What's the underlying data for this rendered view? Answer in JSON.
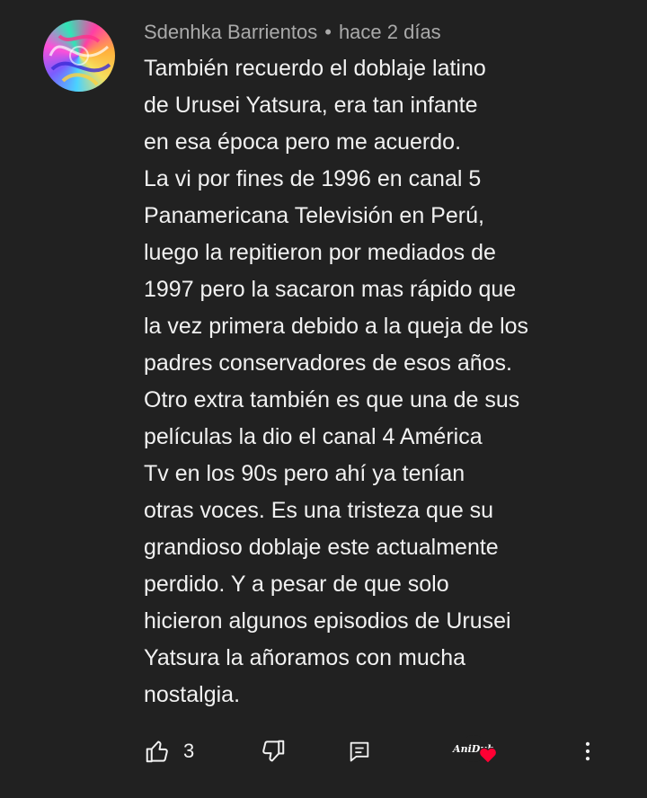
{
  "comment": {
    "author": "Sdenhka Barrientos",
    "separator": "•",
    "time": "hace 2 días",
    "lines": [
      "También recuerdo el doblaje latino",
      "de Urusei Yatsura, era tan infante",
      "en esa época pero me acuerdo.",
      "La vi por fines de 1996 en canal 5",
      "Panamericana Televisión en Perú,",
      "luego la repitieron por mediados de",
      "1997 pero la sacaron mas rápido que",
      "la vez primera debido a la queja de los",
      "padres conservadores de esos años.",
      "Otro extra también es que una de sus",
      "películas la dio el canal 4 América",
      "Tv en los 90s pero ahí ya tenían",
      "otras voces. Es una tristeza que su",
      "grandioso doblaje este actualmente",
      "perdido. Y a pesar de que solo",
      "hicieron algunos episodios de Urusei",
      "Yatsura la añoramos con mucha",
      "nostalgia."
    ]
  },
  "actions": {
    "like_count": "3",
    "creator_badge_text": "AniDub",
    "icons": {
      "like": "thumbs-up-icon",
      "dislike": "thumbs-down-icon",
      "reply": "reply-comment-icon",
      "creator_heart": "creator-heart-icon",
      "more": "more-vertical-icon"
    },
    "heart_color": "#ff0033"
  }
}
